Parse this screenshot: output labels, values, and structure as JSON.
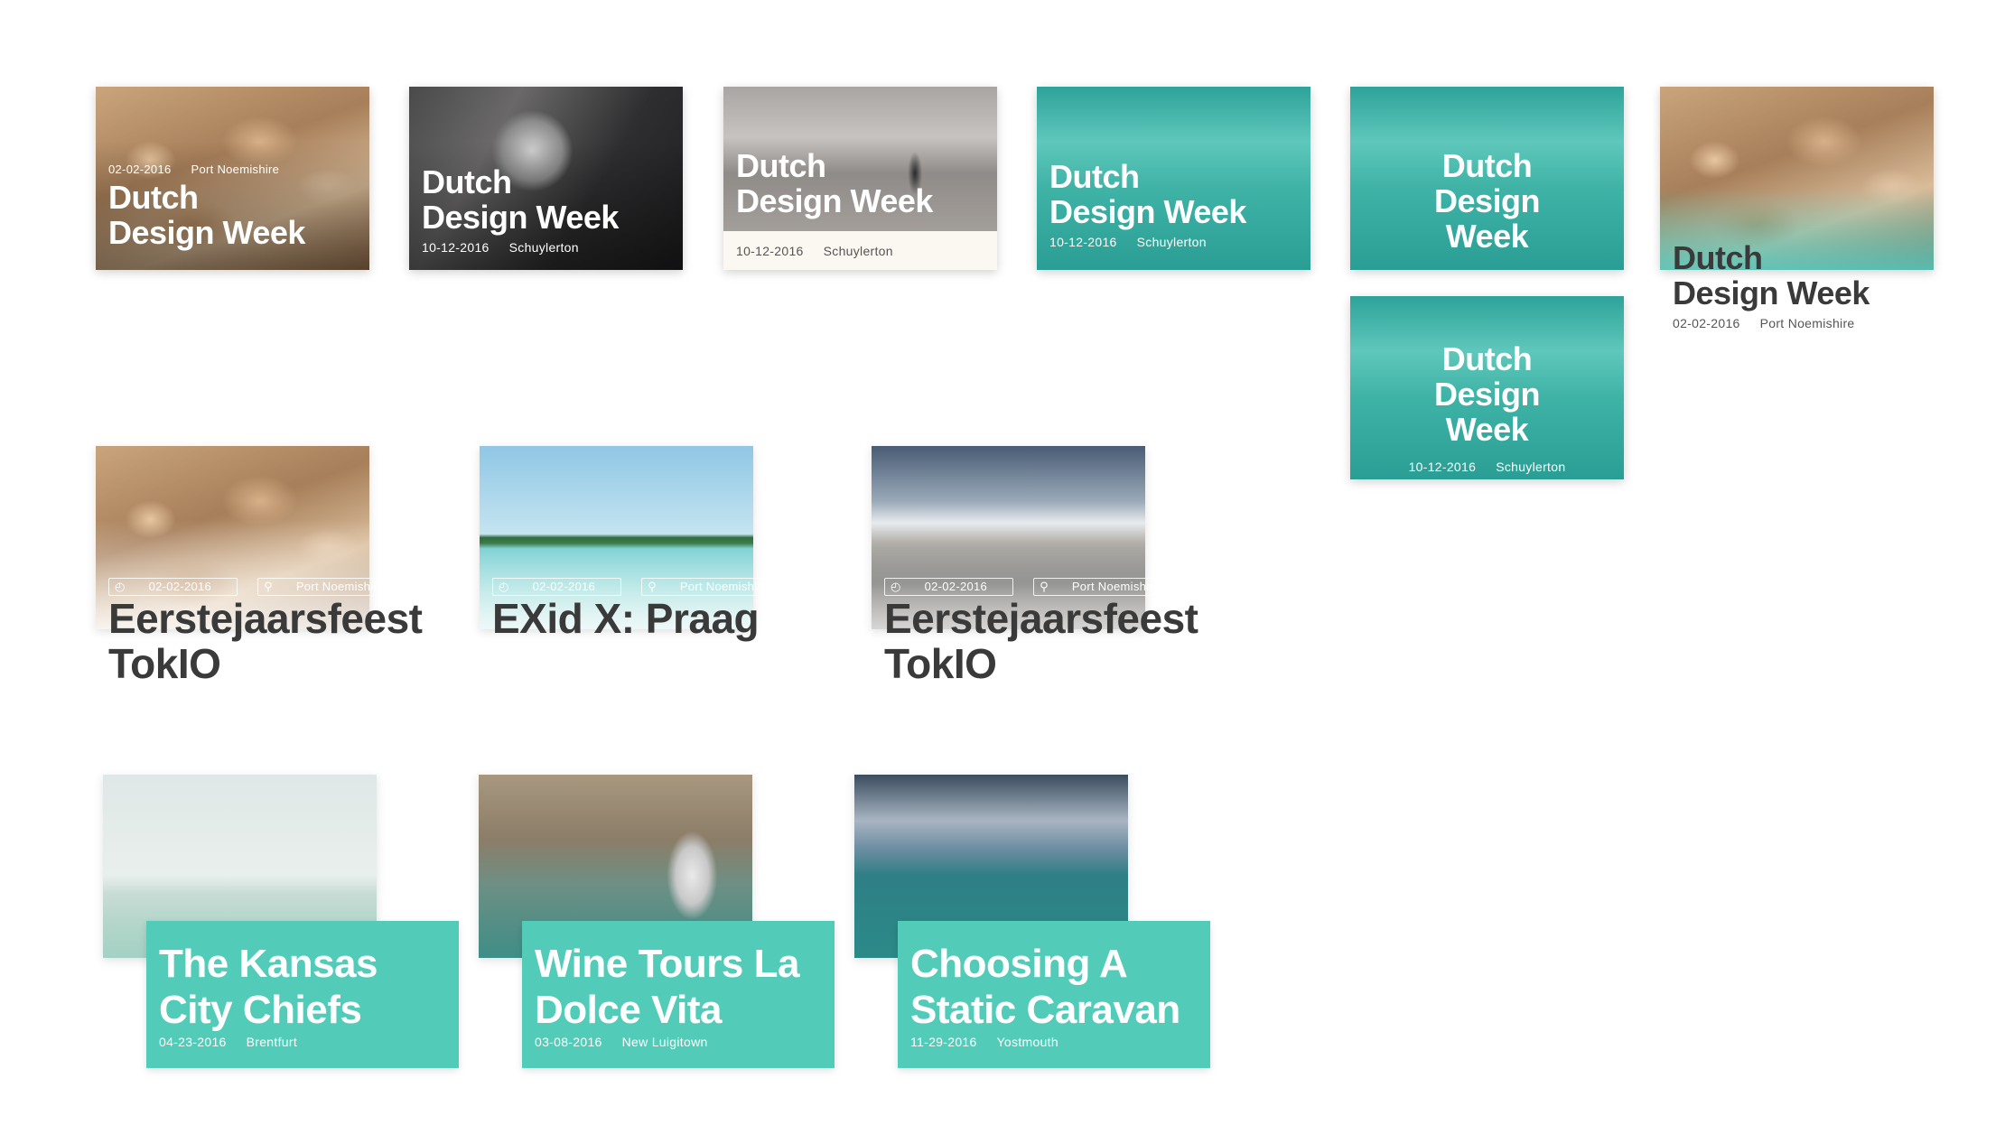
{
  "cards_row1": [
    {
      "title": "Dutch Design Week",
      "date": "02-02-2016",
      "place": "Port Noemishire"
    },
    {
      "title": "Dutch Design Week",
      "date": "10-12-2016",
      "place": "Schuylerton"
    },
    {
      "title": "Dutch Design Week",
      "date": "10-12-2016",
      "place": "Schuylerton"
    },
    {
      "title": "Dutch Design Week",
      "date": "10-12-2016",
      "place": "Schuylerton"
    },
    {
      "title": "Dutch Design Week"
    },
    {
      "title": "Dutch Design Week",
      "date": "10-12-2016",
      "place": "Schuylerton"
    },
    {
      "title": "Dutch Design Week",
      "date": "02-02-2016",
      "place": "Port Noemishire"
    }
  ],
  "cards_row2": [
    {
      "title": "Eerstejaarsfeest TokIO",
      "date": "02-02-2016",
      "place": "Port Noemishire"
    },
    {
      "title": "EXid X: Praag",
      "date": "02-02-2016",
      "place": "Port Noemishire"
    },
    {
      "title": "Eerstejaarsfeest TokIO",
      "date": "02-02-2016",
      "place": "Port Noemishire"
    }
  ],
  "cards_row3": [
    {
      "title": "The Kansas City Chiefs",
      "date": "04-23-2016",
      "place": "Brentfurt"
    },
    {
      "title": "Wine Tours La Dolce Vita",
      "date": "03-08-2016",
      "place": "New Luigitown"
    },
    {
      "title": "Choosing A Static Caravan",
      "date": "11-29-2016",
      "place": "Yostmouth"
    }
  ],
  "colors": {
    "teal": "#52ccb9",
    "dark_text": "#3a3a3a"
  },
  "icons": [
    "clock-icon",
    "location-pin-icon"
  ]
}
